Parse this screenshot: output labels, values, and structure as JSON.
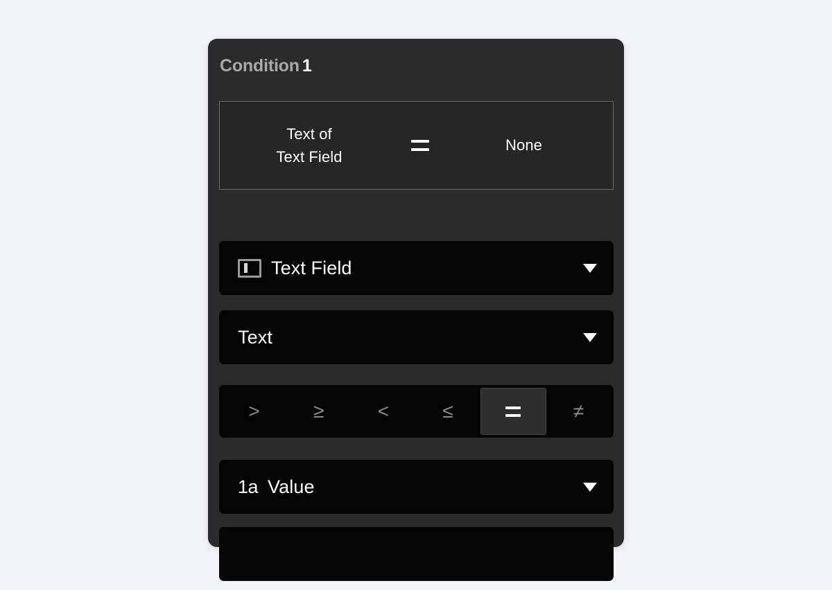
{
  "background_color": "#f2f3f7",
  "card": {
    "background_color": "#2b2b2b",
    "title_prefix": "Condition",
    "title_number": "1",
    "title_prefix_color": "#a9a9a9",
    "title_number_color": "#ffffff"
  },
  "preview": {
    "left_line1": "Text of",
    "left_line2": "Text Field",
    "operator_symbol": "=",
    "operator_icon": "equals-icon",
    "right_value": "None",
    "border_color": "#6b6b6b",
    "background_color": "#262626"
  },
  "element_select": {
    "icon": "text-field-icon",
    "value": "Text Field",
    "caret_icon": "chevron-down-icon"
  },
  "property_select": {
    "value": "Text",
    "caret_icon": "chevron-down-icon"
  },
  "operators": {
    "selected": "=",
    "selected_background": "#2e2e2e",
    "unselected_color": "#8c8c8c",
    "items": [
      {
        "symbol": ">",
        "name": "greater-than",
        "selected": false
      },
      {
        "symbol": "≥",
        "name": "greater-than-or-equal",
        "selected": false
      },
      {
        "symbol": "<",
        "name": "less-than",
        "selected": false
      },
      {
        "symbol": "≤",
        "name": "less-than-or-equal",
        "selected": false
      },
      {
        "symbol": "=",
        "name": "equal",
        "selected": true
      },
      {
        "symbol": "≠",
        "name": "not-equal",
        "selected": false
      }
    ]
  },
  "value_select": {
    "icon": "one-a-icon",
    "icon_label": "1a",
    "value": "Value",
    "caret_icon": "chevron-down-icon"
  },
  "value_input": {
    "value": "",
    "placeholder": ""
  }
}
